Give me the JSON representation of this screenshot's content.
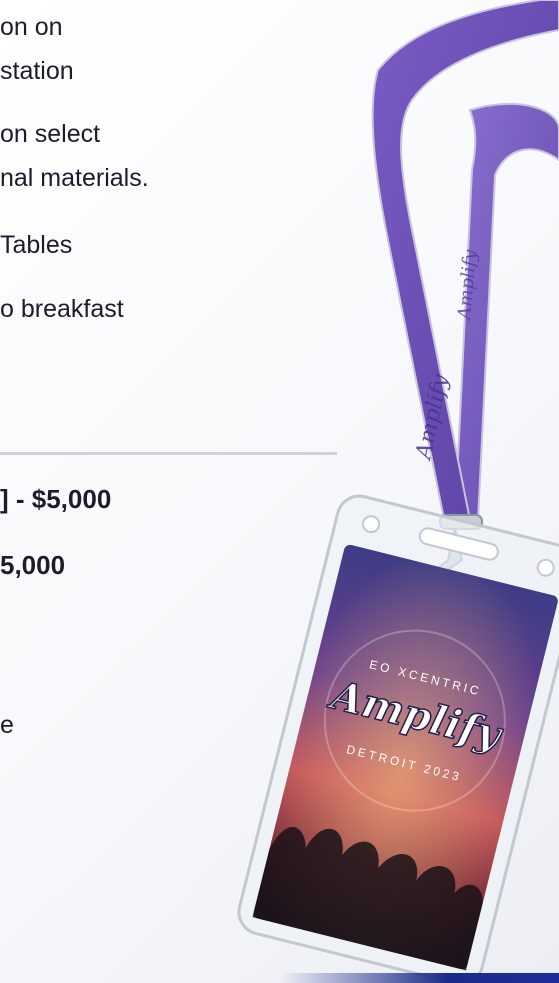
{
  "bullets": [
    "on on",
    "station",
    "on select",
    "nal materials.",
    "Tables",
    "o breakfast"
  ],
  "pricing": [
    "] - $5,000",
    "5,000"
  ],
  "trailing_letter": "e",
  "badge": {
    "brand_script": "Amplify",
    "arc_top": "EO XCENTRIC",
    "arc_bottom": "DETROIT 2023"
  },
  "lanyard": {
    "brand_script": "Amplify"
  },
  "colors": {
    "lanyard_purple": "#6a4cb0",
    "text_dark": "#1b1c2e",
    "accent_navy": "#1c2b88"
  }
}
